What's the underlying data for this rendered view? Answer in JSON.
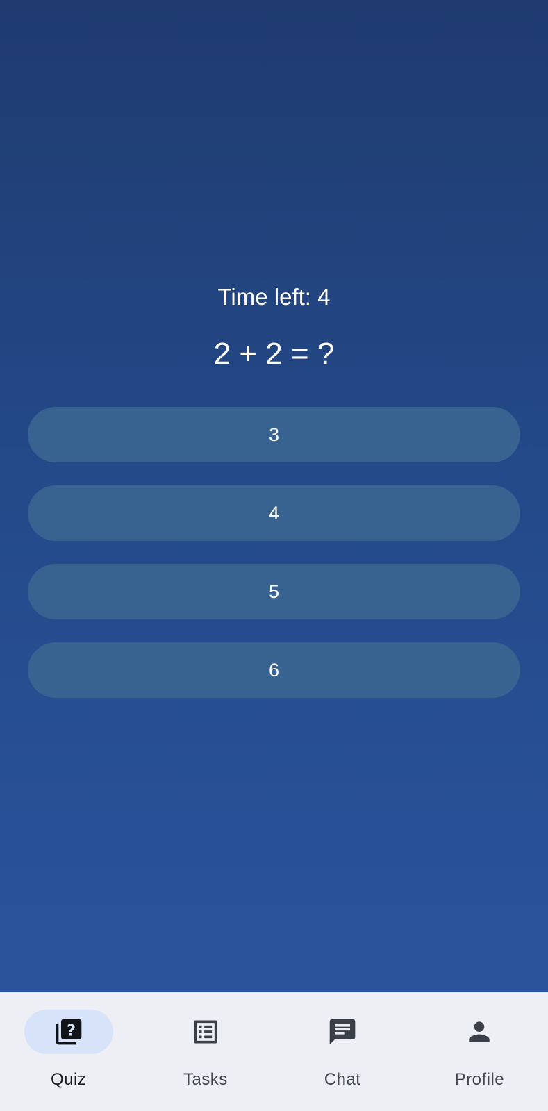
{
  "quiz": {
    "timer_text": "Time left: 4",
    "question": "2 + 2 = ?",
    "answers": [
      "3",
      "4",
      "5",
      "6"
    ]
  },
  "bottom_nav": {
    "items": [
      {
        "label": "Quiz",
        "icon": "quiz-icon",
        "active": true
      },
      {
        "label": "Tasks",
        "icon": "list-icon",
        "active": false
      },
      {
        "label": "Chat",
        "icon": "chat-icon",
        "active": false
      },
      {
        "label": "Profile",
        "icon": "person-icon",
        "active": false
      }
    ]
  },
  "colors": {
    "background_top": "#1f3b70",
    "background_bottom": "#2a539c",
    "answer_button": "#386290",
    "nav_background": "#edeff4",
    "nav_active_pill": "#d7e3f8",
    "icon": "#3b3f47"
  }
}
